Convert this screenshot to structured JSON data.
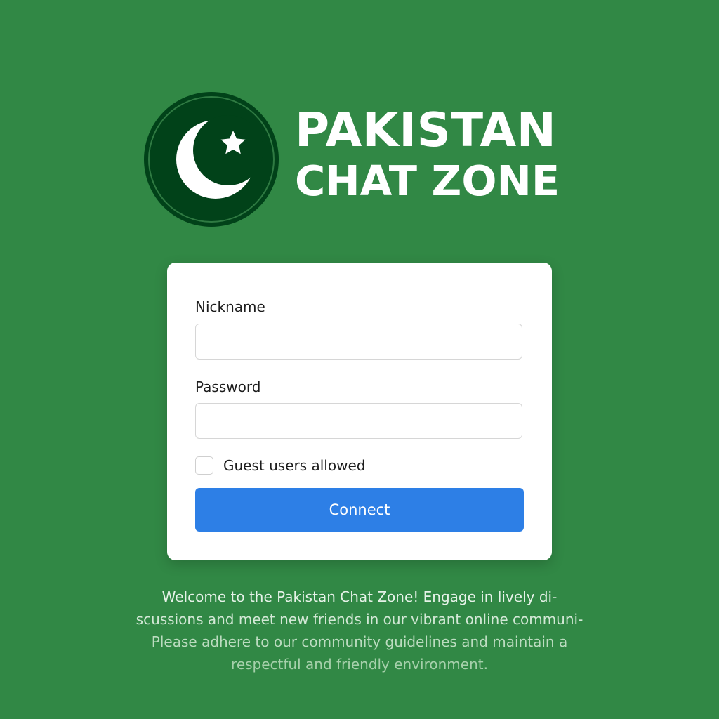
{
  "brand": {
    "line1": "PAKISTAN",
    "line2": "CHAT ZONE",
    "logo_icon": "crescent-star-icon"
  },
  "colors": {
    "background": "#318845",
    "logo_circle": "#013f18",
    "button": "#2d7fe6"
  },
  "form": {
    "nickname_label": "Nickname",
    "nickname_value": "",
    "password_label": "Password",
    "password_value": "",
    "guest_label": "Guest users allowed",
    "guest_checked": false,
    "connect_label": "Connect"
  },
  "welcome": {
    "line1": "Welcome to the Pakistan Chat Zone! Engage in lively di-",
    "line2": "scussions and meet new friends in our vibrant online communi-",
    "line3": "Please adhere to our community guidelines and maintain a",
    "line4": "respectful and friendly environment."
  }
}
